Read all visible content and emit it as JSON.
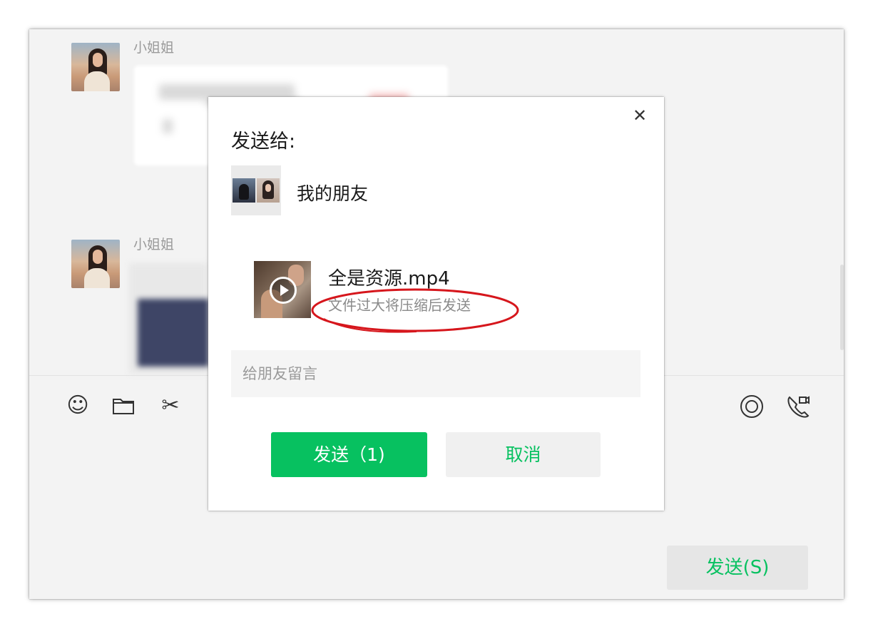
{
  "chat": {
    "messages": [
      {
        "sender": "小姐姐"
      },
      {
        "sender": "小姐姐"
      }
    ],
    "toolbar": {
      "left_icons": [
        "emoji-icon",
        "folder-icon",
        "scissors-icon",
        "chat-history-icon"
      ],
      "right_icons": [
        "live-icon",
        "video-call-icon"
      ]
    },
    "send_button_label": "发送(S)"
  },
  "dialog": {
    "title": "发送给:",
    "recipient": {
      "name": "我的朋友"
    },
    "file": {
      "name": "全是资源.mp4",
      "note": "文件过大将压缩后发送"
    },
    "message_placeholder": "给朋友留言",
    "send_label": "发送（1)",
    "cancel_label": "取消",
    "close_icon": "close-icon"
  },
  "colors": {
    "accent": "#07c160",
    "annotation": "#d6161c"
  }
}
